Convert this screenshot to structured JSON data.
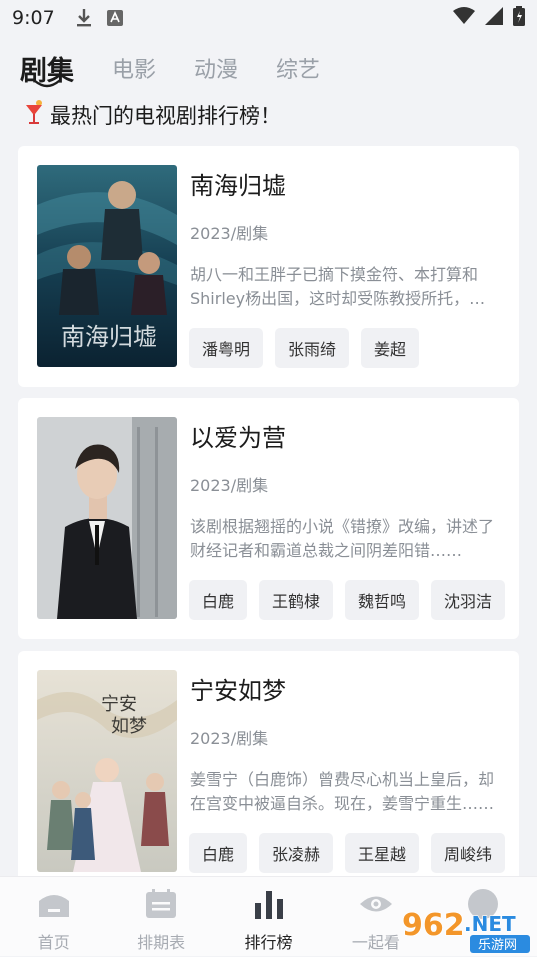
{
  "status_bar": {
    "time": "9:07"
  },
  "tabs": [
    {
      "label": "剧集",
      "active": true
    },
    {
      "label": "电影",
      "active": false
    },
    {
      "label": "动漫",
      "active": false
    },
    {
      "label": "综艺",
      "active": false
    }
  ],
  "headline": "最热门的电视剧排行榜！",
  "cards": [
    {
      "title": "南海归墟",
      "meta": "2023/剧集",
      "desc": "胡八一和王胖子已摘下摸金符、本打算和Shirley杨出国，这时却受陈教授所托，前往南海归墟寻找秦王照骨镜……",
      "tags": [
        "潘粤明",
        "张雨绮",
        "姜超"
      ]
    },
    {
      "title": "以爱为营",
      "meta": "2023/剧集",
      "desc": "该剧根据翘摇的小说《错撩》改编，讲述了财经记者和霸道总裁之间阴差阳错……",
      "tags": [
        "白鹿",
        "王鹤棣",
        "魏哲鸣",
        "沈羽洁"
      ]
    },
    {
      "title": "宁安如梦",
      "meta": "2023/剧集",
      "desc": "姜雪宁（白鹿饰）曾费尽心机当上皇后，却在宫变中被逼自杀。现在，姜雪宁重生……",
      "tags": [
        "白鹿",
        "张凌赫",
        "王星越",
        "周峻纬"
      ]
    }
  ],
  "bottom_nav": [
    {
      "label": "首页",
      "icon": "home-icon",
      "active": false
    },
    {
      "label": "排期表",
      "icon": "calendar-icon",
      "active": false
    },
    {
      "label": "排行榜",
      "icon": "bar-chart-icon",
      "active": true
    },
    {
      "label": "一起看",
      "icon": "eye-icon",
      "active": false
    },
    {
      "label": "",
      "icon": "avatar-icon",
      "active": false
    }
  ],
  "watermark": {
    "brand": "962.NET",
    "sub": "乐游网"
  },
  "colors": {
    "active_text": "#1c1c1c",
    "inactive_text": "#9aa0a8",
    "nav_active": "#3a3f48"
  }
}
